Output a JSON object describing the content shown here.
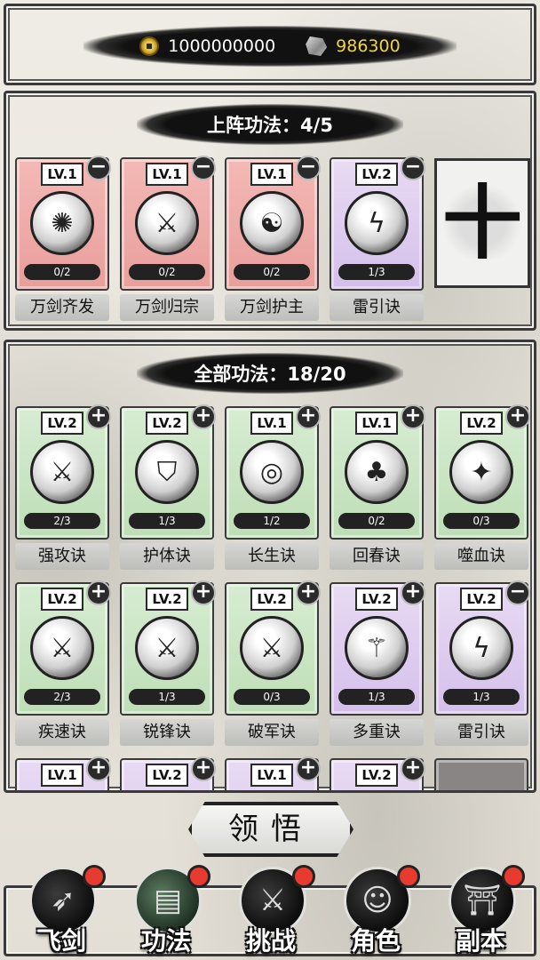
{
  "currency": {
    "coins": "1000000000",
    "stones": "986300"
  },
  "active_section": {
    "title": "上阵功法：4/5",
    "cards": [
      {
        "level": "LV.1",
        "progress": "0/2",
        "name": "万剑齐发",
        "color": "red",
        "action": "−",
        "icon": "sunburst-icon"
      },
      {
        "level": "LV.1",
        "progress": "0/2",
        "name": "万剑归宗",
        "color": "red",
        "action": "−",
        "icon": "sword-icon"
      },
      {
        "level": "LV.1",
        "progress": "0/2",
        "name": "万剑护主",
        "color": "red",
        "action": "−",
        "icon": "meditation-icon"
      },
      {
        "level": "LV.2",
        "progress": "1/3",
        "name": "雷引诀",
        "color": "purple",
        "action": "−",
        "icon": "lightning-sword-icon"
      }
    ],
    "empty_slot_glyph": "十"
  },
  "all_section": {
    "title": "全部功法：18/20",
    "rows": [
      [
        {
          "level": "LV.2",
          "progress": "2/3",
          "name": "强攻诀",
          "color": "green",
          "action": "+",
          "icon": "sword-icon"
        },
        {
          "level": "LV.2",
          "progress": "1/3",
          "name": "护体诀",
          "color": "green",
          "action": "+",
          "icon": "shield-icon"
        },
        {
          "level": "LV.1",
          "progress": "1/2",
          "name": "长生诀",
          "color": "green",
          "action": "+",
          "icon": "swirl-icon"
        },
        {
          "level": "LV.1",
          "progress": "0/2",
          "name": "回春诀",
          "color": "green",
          "action": "+",
          "icon": "tree-icon"
        },
        {
          "level": "LV.2",
          "progress": "0/3",
          "name": "噬血诀",
          "color": "green",
          "action": "+",
          "icon": "flame-sword-icon"
        }
      ],
      [
        {
          "level": "LV.2",
          "progress": "2/3",
          "name": "疾速诀",
          "color": "green",
          "action": "+",
          "icon": "crossed-swords-icon"
        },
        {
          "level": "LV.2",
          "progress": "1/3",
          "name": "锐锋诀",
          "color": "green",
          "action": "+",
          "icon": "sword-icon"
        },
        {
          "level": "LV.2",
          "progress": "0/3",
          "name": "破军诀",
          "color": "green",
          "action": "+",
          "icon": "sword-icon"
        },
        {
          "level": "LV.2",
          "progress": "1/3",
          "name": "多重诀",
          "color": "purple",
          "action": "+",
          "icon": "multi-sword-icon"
        },
        {
          "level": "LV.2",
          "progress": "1/3",
          "name": "雷引诀",
          "color": "purple",
          "action": "−",
          "icon": "lightning-sword-icon"
        }
      ],
      [
        {
          "level": "LV.1",
          "color": "purple",
          "action": "+"
        },
        {
          "level": "LV.2",
          "color": "purple",
          "action": "+"
        },
        {
          "level": "LV.1",
          "color": "purple",
          "action": "+"
        },
        {
          "level": "LV.2",
          "color": "purple",
          "action": "+"
        }
      ]
    ]
  },
  "comprehend_label": "领悟",
  "nav": [
    {
      "label": "飞剑",
      "icon": "flying-sword-icon",
      "active": false
    },
    {
      "label": "功法",
      "icon": "scroll-icon",
      "active": true
    },
    {
      "label": "挑战",
      "icon": "crossed-swords-icon",
      "active": false
    },
    {
      "label": "角色",
      "icon": "character-icon",
      "active": false
    },
    {
      "label": "副本",
      "icon": "gate-icon",
      "active": false
    }
  ]
}
